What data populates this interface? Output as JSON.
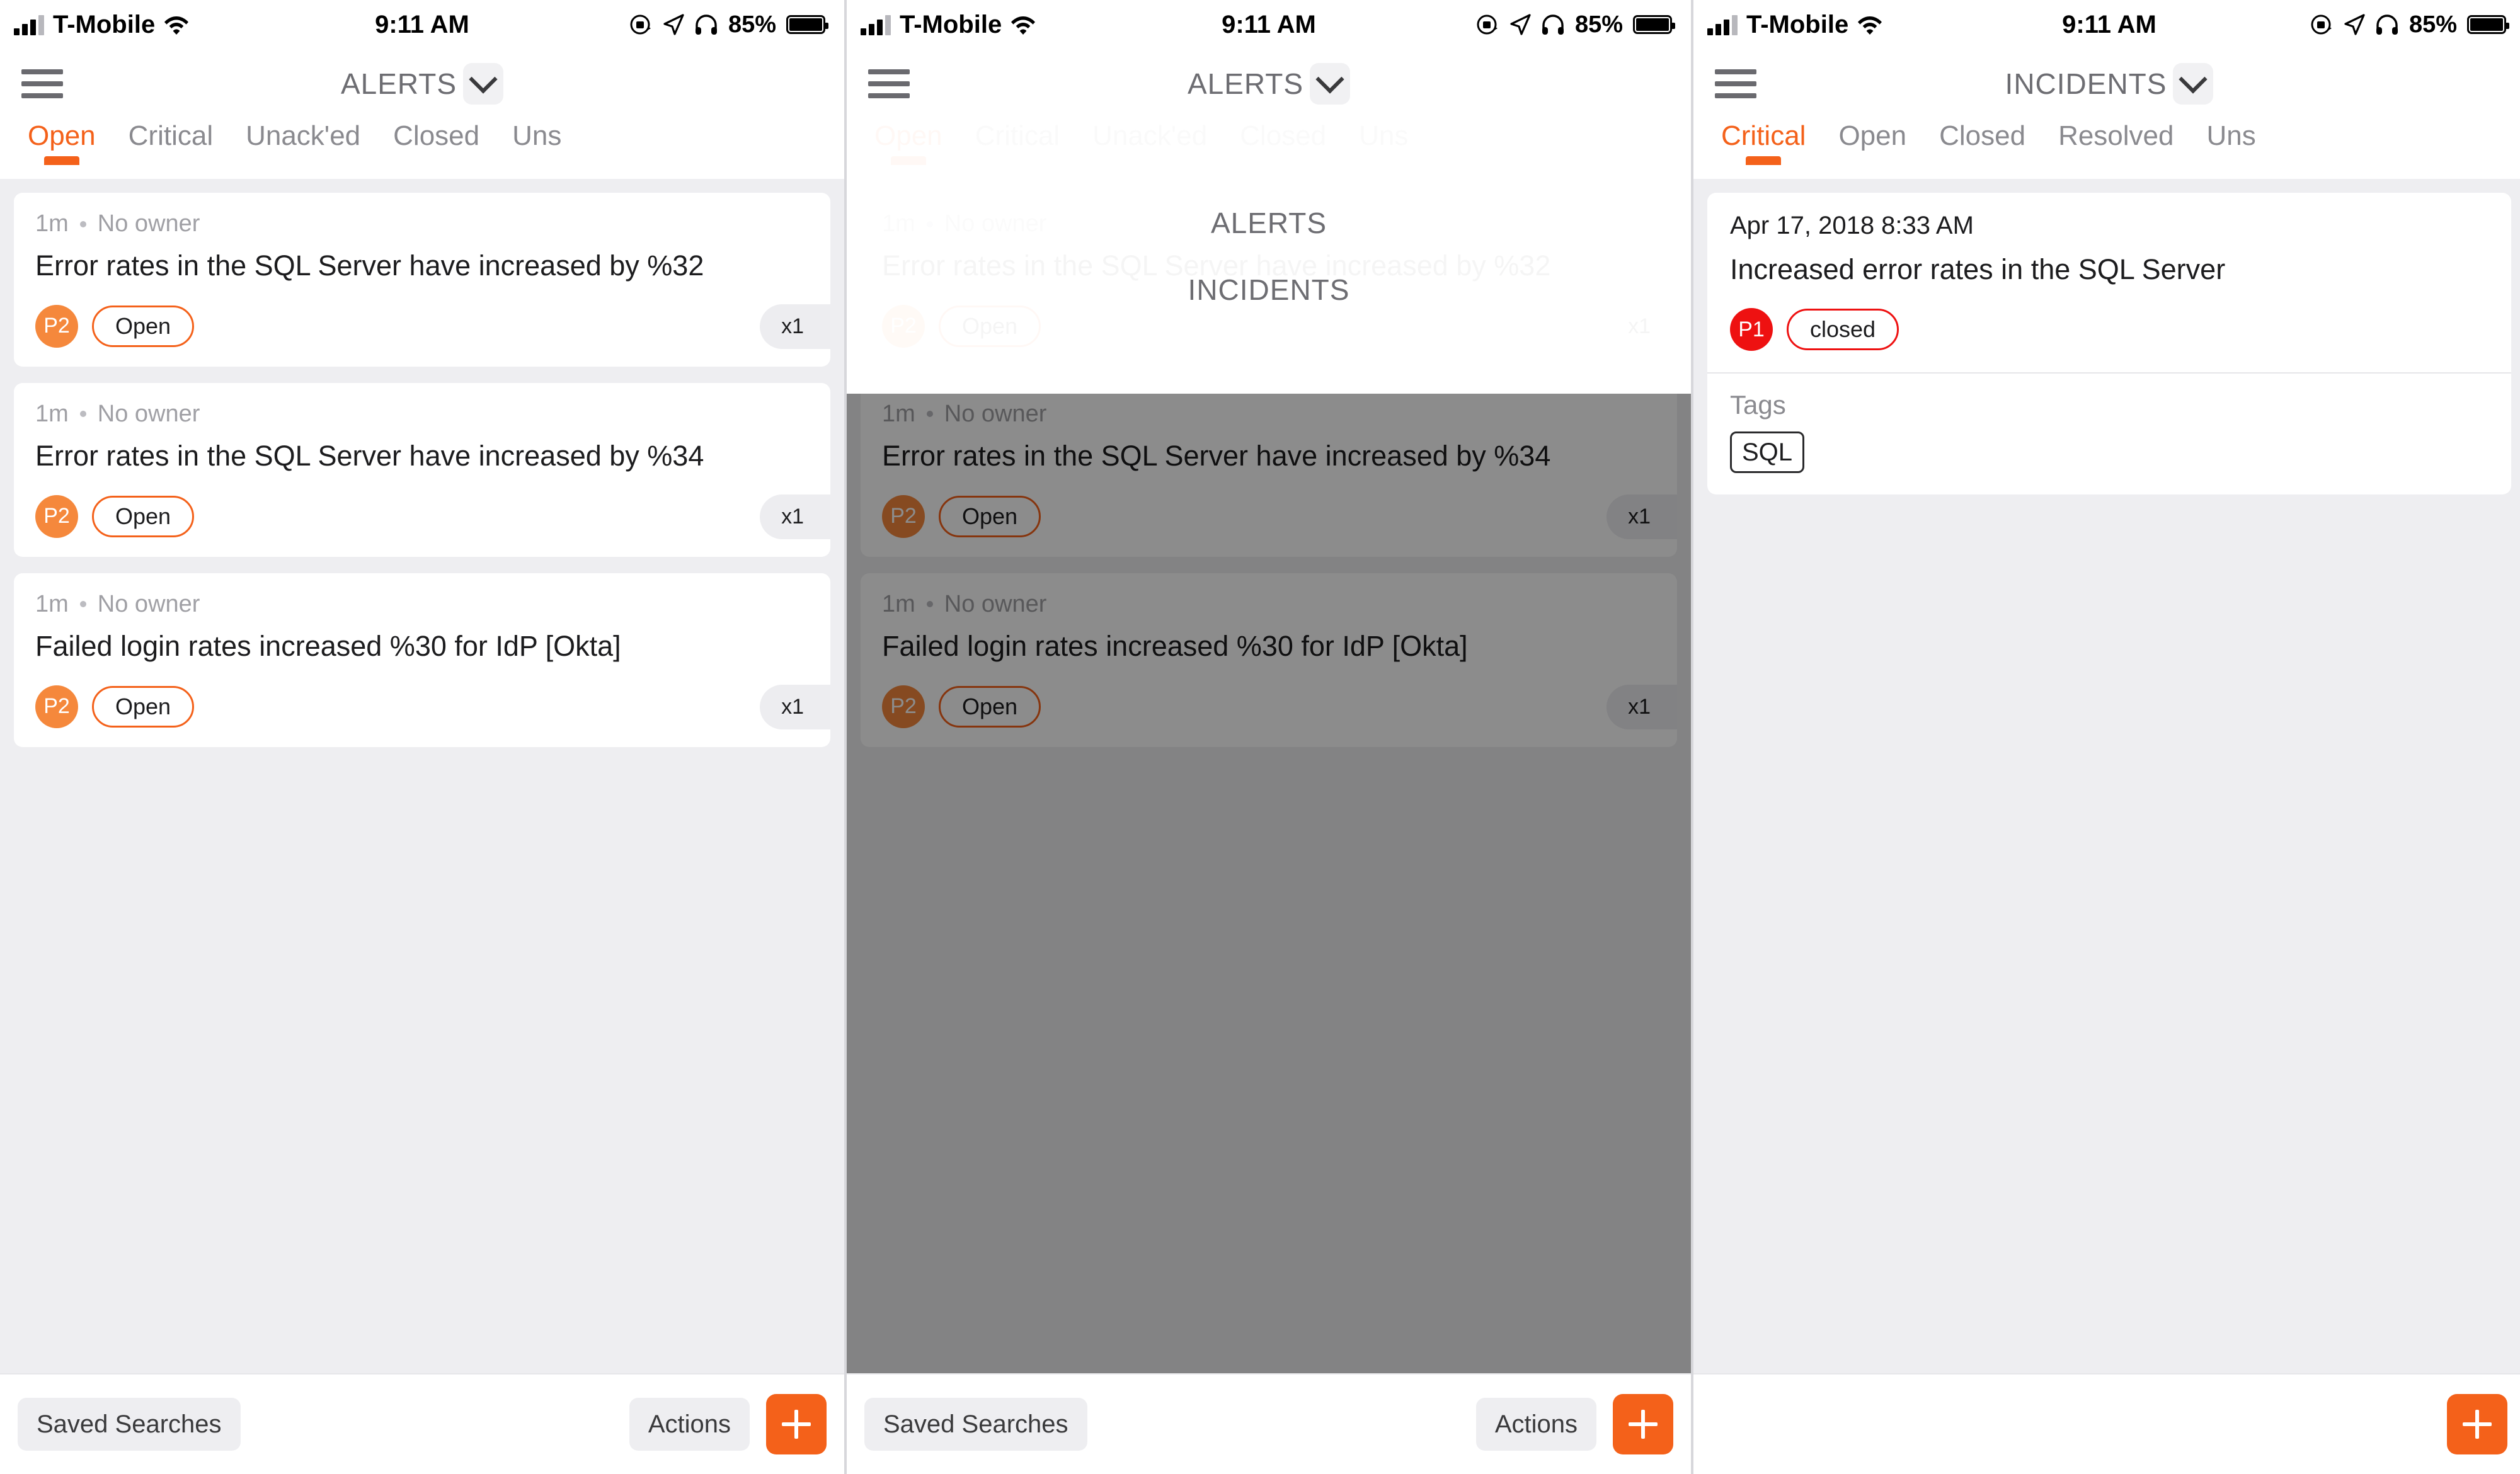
{
  "statusbar": {
    "carrier": "T-Mobile",
    "time": "9:11 AM",
    "battery_pct": "85%",
    "icons": [
      "signal-bars-icon",
      "wifi-icon",
      "rotation-lock-icon",
      "location-arrow-icon",
      "headphones-icon",
      "battery-icon"
    ]
  },
  "panel_alerts": {
    "nav": {
      "title": "ALERTS",
      "menu_icon": "hamburger-icon",
      "chevron_icon": "chevron-down-icon"
    },
    "tabs": [
      {
        "label": "Open",
        "active": true
      },
      {
        "label": "Critical",
        "active": false
      },
      {
        "label": "Unack'ed",
        "active": false
      },
      {
        "label": "Closed",
        "active": false
      },
      {
        "label": "Uns",
        "active": false
      }
    ],
    "cards": [
      {
        "time": "1m",
        "owner": "No owner",
        "title": "Error rates in the SQL Server have increased by %32",
        "priority": "P2",
        "state": "Open",
        "count": "x1"
      },
      {
        "time": "1m",
        "owner": "No owner",
        "title": "Error rates in the SQL Server have increased by %34",
        "priority": "P2",
        "state": "Open",
        "count": "x1"
      },
      {
        "time": "1m",
        "owner": "No owner",
        "title": "Failed login rates increased %30 for IdP [Okta]",
        "priority": "P2",
        "state": "Open",
        "count": "x1"
      }
    ],
    "bottombar": {
      "saved_searches": "Saved Searches",
      "actions": "Actions",
      "add": "+"
    }
  },
  "panel_dropdown": {
    "nav": {
      "title": "ALERTS",
      "menu_icon": "hamburger-icon",
      "chevron_icon": "chevron-down-icon"
    },
    "tabs": [
      {
        "label": "Open",
        "active": true
      },
      {
        "label": "Critical",
        "active": false
      },
      {
        "label": "Unack'ed",
        "active": false
      },
      {
        "label": "Closed",
        "active": false
      },
      {
        "label": "Uns",
        "active": false
      }
    ],
    "menu_options": [
      {
        "label": "ALERTS",
        "selected": true
      },
      {
        "label": "INCIDENTS",
        "selected": false
      }
    ],
    "cards": [
      {
        "time": "1m",
        "owner": "No owner",
        "title": "Error rates in the SQL Server have increased by %32",
        "priority": "P2",
        "state": "Open",
        "count": "x1"
      },
      {
        "time": "1m",
        "owner": "No owner",
        "title": "Error rates in the SQL Server have increased by %34",
        "priority": "P2",
        "state": "Open",
        "count": "x1"
      },
      {
        "time": "1m",
        "owner": "No owner",
        "title": "Failed login rates increased %30 for IdP [Okta]",
        "priority": "P2",
        "state": "Open",
        "count": "x1"
      }
    ],
    "bottombar": {
      "saved_searches": "Saved Searches",
      "actions": "Actions",
      "add": "+"
    }
  },
  "panel_incidents": {
    "nav": {
      "title": "INCIDENTS",
      "menu_icon": "hamburger-icon",
      "chevron_icon": "chevron-down-icon"
    },
    "tabs": [
      {
        "label": "Critical",
        "active": true
      },
      {
        "label": "Open",
        "active": false
      },
      {
        "label": "Closed",
        "active": false
      },
      {
        "label": "Resolved",
        "active": false
      },
      {
        "label": "Uns",
        "active": false
      }
    ],
    "detail": {
      "date": "Apr 17, 2018 8:33 AM",
      "title": "Increased error rates in the SQL Server",
      "priority": "P1",
      "state": "closed",
      "tags_label": "Tags",
      "tags": [
        "SQL"
      ]
    },
    "bottombar": {
      "add": "+"
    }
  },
  "colors": {
    "accent_orange": "#f4611a",
    "priority_p2": "#f5883c",
    "priority_p1": "#ee1111",
    "tab_inactive": "#8a8a8f",
    "list_background": "#eeeef1"
  }
}
